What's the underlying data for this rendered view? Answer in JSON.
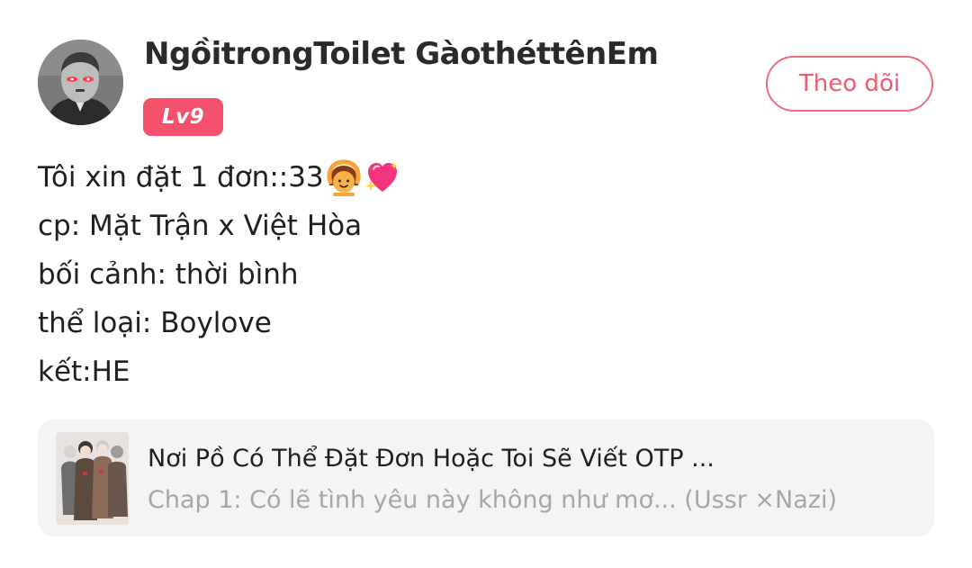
{
  "post": {
    "author": {
      "name": "NgồitrongToilet GàothéttênEm",
      "level": "Lv9",
      "avatar_icon": "profile-photo"
    },
    "follow_label": "Theo dõi",
    "lines": [
      "Tôi xin đặt 1 đơn::33",
      "cp: Mặt Trận x Việt Hòa",
      "bối cảnh: thời bình",
      "thể loại: Boylove",
      "kết:HE"
    ],
    "emojis": [
      "person-gesturing-ok-emoji",
      "sparkling-heart-emoji"
    ],
    "story": {
      "title": "Nơi Pồ Có Thể Đặt Đơn Hoặc Toi Sẽ Viết OTP ...",
      "chapter": "Chap 1: Có lẽ tình yêu này không như mơ... (Ussr ×Nazi)"
    }
  },
  "colors": {
    "accent": "#f4516c",
    "follow_border": "#ee6b7d",
    "card_background": "#f4f4f4",
    "muted_text": "#a7a7a7"
  }
}
